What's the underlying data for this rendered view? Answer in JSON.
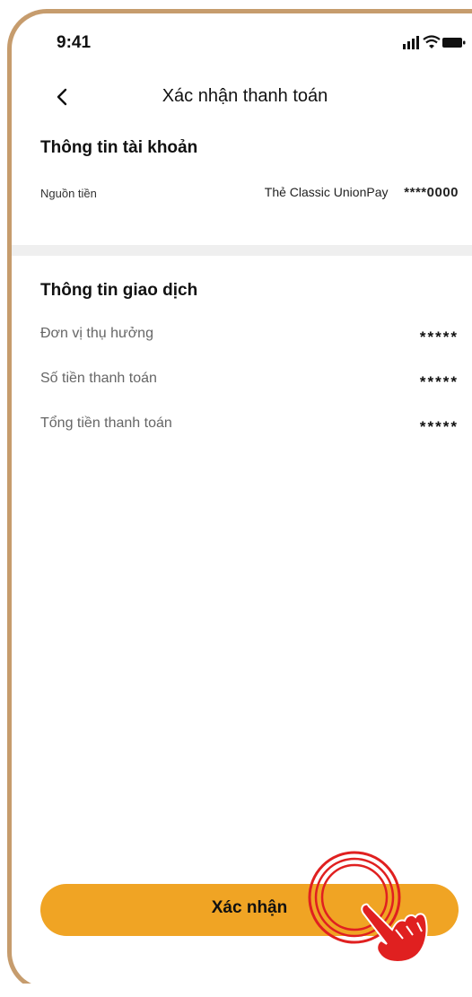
{
  "status": {
    "time": "9:41"
  },
  "header": {
    "title": "Xác nhận thanh toán"
  },
  "account": {
    "title": "Thông tin tài khoản",
    "source_label": "Nguồn tiền",
    "source_value": "Thẻ Classic UnionPay",
    "card_masked": "****0000"
  },
  "transaction": {
    "title": "Thông tin giao dịch",
    "rows": [
      {
        "label": "Đơn vị thụ hưởng",
        "value": "*****"
      },
      {
        "label": "Số tiền thanh toán",
        "value": "*****"
      },
      {
        "label": "Tổng tiền thanh toán",
        "value": "*****"
      }
    ]
  },
  "actions": {
    "confirm_label": "Xác nhận"
  },
  "colors": {
    "accent": "#f0a424",
    "frame": "#c69c6d",
    "tap_highlight": "#e02020"
  },
  "icons": [
    "back-chevron-icon",
    "signal-icon",
    "wifi-icon",
    "battery-icon",
    "tap-hand-icon"
  ]
}
